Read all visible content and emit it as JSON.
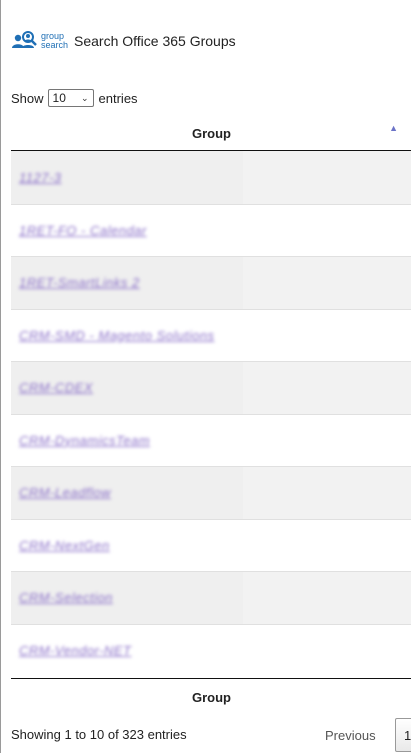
{
  "header": {
    "logo_line1": "group",
    "logo_line2": "search",
    "title": "Search Office 365 Groups"
  },
  "length_menu": {
    "prefix": "Show",
    "selected": "10",
    "suffix": "entries"
  },
  "table": {
    "column_header": "Group",
    "column_footer": "Group",
    "rows": [
      "1127-3",
      "1RET-FO - Calendar",
      "1RET-SmartLinks 2",
      "CRM-SMD - Magento Solutions",
      "CRM-CDEX",
      "CRM-DynamicsTeam",
      "CRM-Leadflow",
      "CRM-NextGen",
      "CRM-Selection",
      "CRM-Vendor-NET"
    ]
  },
  "footer": {
    "info": "Showing 1 to 10 of 323 entries",
    "previous": "Previous",
    "next_partial": "1"
  },
  "colors": {
    "link_blurred": "#8a6fc8",
    "sort_indicator": "#6b73c7",
    "stripe": "#f2f2f2"
  }
}
